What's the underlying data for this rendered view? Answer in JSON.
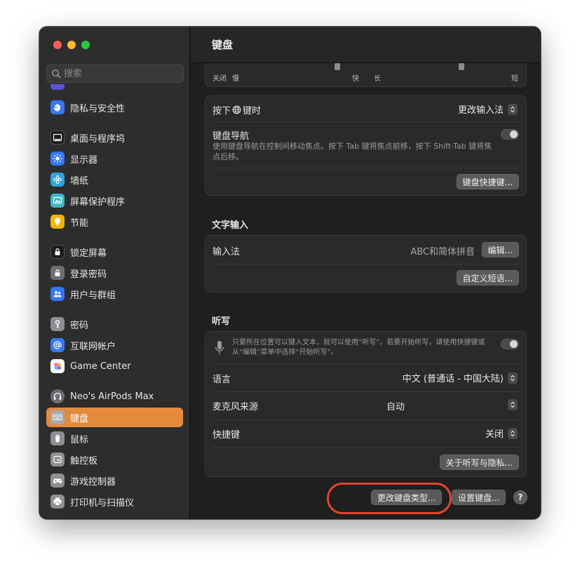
{
  "window": {
    "title": "键盘"
  },
  "colors": {
    "accent": "#e38a3d",
    "close": "#ff5f57",
    "minimize": "#febc2e",
    "zoom": "#28c840",
    "annotation": "#e5442d"
  },
  "sidebar": {
    "search_placeholder": "搜索",
    "items": [
      {
        "label": "隐私与安全性",
        "icon": "hand-icon",
        "color": "#3478f6"
      },
      {
        "label": "桌面与程序坞",
        "icon": "dock-icon",
        "color": "#1c1c1e"
      },
      {
        "label": "显示器",
        "icon": "sun-icon",
        "color": "#3478f6"
      },
      {
        "label": "墙纸",
        "icon": "flower-icon",
        "color": "#30a4d9"
      },
      {
        "label": "屏幕保护程序",
        "icon": "screensaver-icon",
        "color": "#40b7c9"
      },
      {
        "label": "节能",
        "icon": "bulb-icon",
        "color": "#f4b400"
      },
      {
        "label": "锁定屏幕",
        "icon": "lock-screen-icon",
        "color": "#1c1c1e"
      },
      {
        "label": "登录密码",
        "icon": "lock-icon",
        "color": "#6e6e73"
      },
      {
        "label": "用户与群组",
        "icon": "users-icon",
        "color": "#3478f6"
      },
      {
        "label": "密码",
        "icon": "key-icon",
        "color": "#8e8e93"
      },
      {
        "label": "互联网帐户",
        "icon": "at-icon",
        "color": "#3478f6"
      },
      {
        "label": "Game Center",
        "icon": "game-center-icon",
        "color": "#ffffff"
      },
      {
        "label": "Neo's AirPods Max",
        "icon": "headphones-icon",
        "color": "#6e6e73"
      },
      {
        "label": "键盘",
        "icon": "keyboard-icon",
        "color": "#8e8e93"
      },
      {
        "label": "鼠标",
        "icon": "mouse-icon",
        "color": "#8e8e93"
      },
      {
        "label": "触控板",
        "icon": "trackpad-icon",
        "color": "#8e8e93"
      },
      {
        "label": "游戏控制器",
        "icon": "gamepad-icon",
        "color": "#8e8e93"
      },
      {
        "label": "打印机与扫描仪",
        "icon": "printer-icon",
        "color": "#8e8e93"
      }
    ]
  },
  "slider": {
    "labels": [
      "关闭",
      "慢",
      "快",
      "长",
      "短"
    ]
  },
  "keyboard_group": {
    "press_key_label": "按下",
    "press_key_suffix": "键时",
    "press_key_value": "更改输入法",
    "nav_label": "键盘导航",
    "nav_desc": "使用键盘导航在控制间移动焦点。按下 Tab 键将焦点前移，按下 Shift-Tab 键将焦点后移。",
    "shortcuts_button": "键盘快捷键..."
  },
  "text_input": {
    "title": "文字输入",
    "input_label": "输入法",
    "input_value": "ABC和简体拼音",
    "edit_button": "编辑...",
    "custom_button": "自定义短语..."
  },
  "dictation": {
    "title": "听写",
    "desc": "只要所在位置可以键入文本，就可以使用“听写”。若要开始听写，请使用快捷键或从“编辑”菜单中选择“开始听写”。",
    "language_label": "语言",
    "language_value": "中文 (普通话 - 中国大陆)",
    "mic_label": "麦克风来源",
    "mic_value": "自动",
    "shortcut_label": "快捷键",
    "shortcut_value": "关闭",
    "privacy_button": "关于听写与隐私..."
  },
  "footer": {
    "change_type_button": "更改键盘类型...",
    "setup_button": "设置键盘...",
    "help_button": "?"
  }
}
